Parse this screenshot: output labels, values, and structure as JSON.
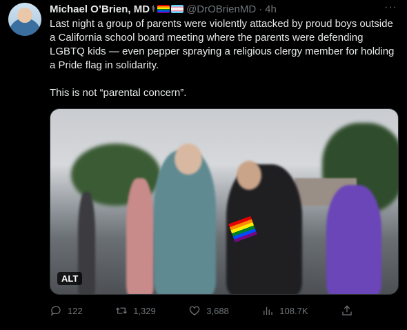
{
  "author": {
    "display_name": "Michael O’Brien, MD",
    "handle": "@DrOBrienMD",
    "separator": "·",
    "time": "4h",
    "emojis": [
      "stethoscope-icon",
      "rainbow-flag-icon",
      "transgender-flag-icon"
    ]
  },
  "tweet": {
    "paragraph1": "Last night a group of parents were violently attacked by proud boys outside a California school board meeting where the parents were defending LGBTQ kids — even pepper spraying a religious clergy member for holding a Pride flag in solidarity.",
    "paragraph2": "This is not “parental concern”."
  },
  "media": {
    "alt_badge": "ALT"
  },
  "actions": {
    "replies": "122",
    "retweets": "1,329",
    "likes": "3,688",
    "views": "108.7K"
  },
  "colors": {
    "background": "#000000",
    "text": "#e7e9ea",
    "secondary": "#71767b"
  }
}
